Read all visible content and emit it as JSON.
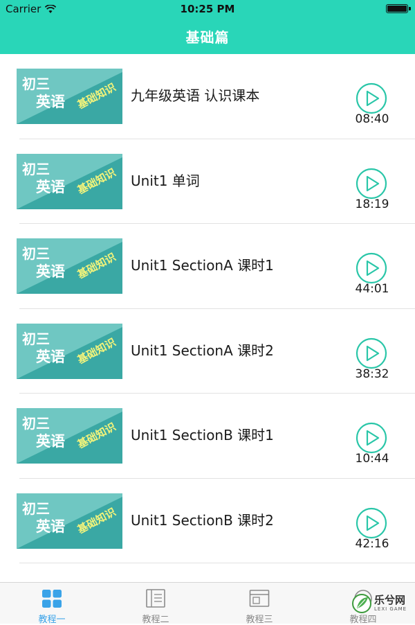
{
  "status_bar": {
    "carrier": "Carrier",
    "time": "10:25 PM"
  },
  "nav": {
    "title": "基础篇"
  },
  "thumbnail": {
    "line1": "初三",
    "line2": "英语",
    "tag": "基础知识"
  },
  "lessons": [
    {
      "title": "九年级英语 认识课本",
      "duration": "08:40"
    },
    {
      "title": "Unit1 单词",
      "duration": "18:19"
    },
    {
      "title": "Unit1 SectionA 课时1",
      "duration": "44:01"
    },
    {
      "title": "Unit1 SectionA 课时2",
      "duration": "38:32"
    },
    {
      "title": "Unit1 SectionB 课时1",
      "duration": "10:44"
    },
    {
      "title": "Unit1 SectionB 课时2",
      "duration": "42:16"
    }
  ],
  "tabs": [
    {
      "label": "教程一",
      "icon": "grid-icon",
      "active": true
    },
    {
      "label": "教程二",
      "icon": "book-icon",
      "active": false
    },
    {
      "label": "教程三",
      "icon": "browser-window-icon",
      "active": false
    },
    {
      "label": "教程四",
      "icon": "logo-icon",
      "active": false
    }
  ],
  "watermark": {
    "text": "乐兮网",
    "sub": "LEXI GAME"
  },
  "colors": {
    "header": "#29d6b8",
    "accent": "#29c6a8",
    "tab_active": "#3aa3e8",
    "thumb_bg": "#6fc7c2",
    "thumb_dark": "#3aa8a4"
  }
}
